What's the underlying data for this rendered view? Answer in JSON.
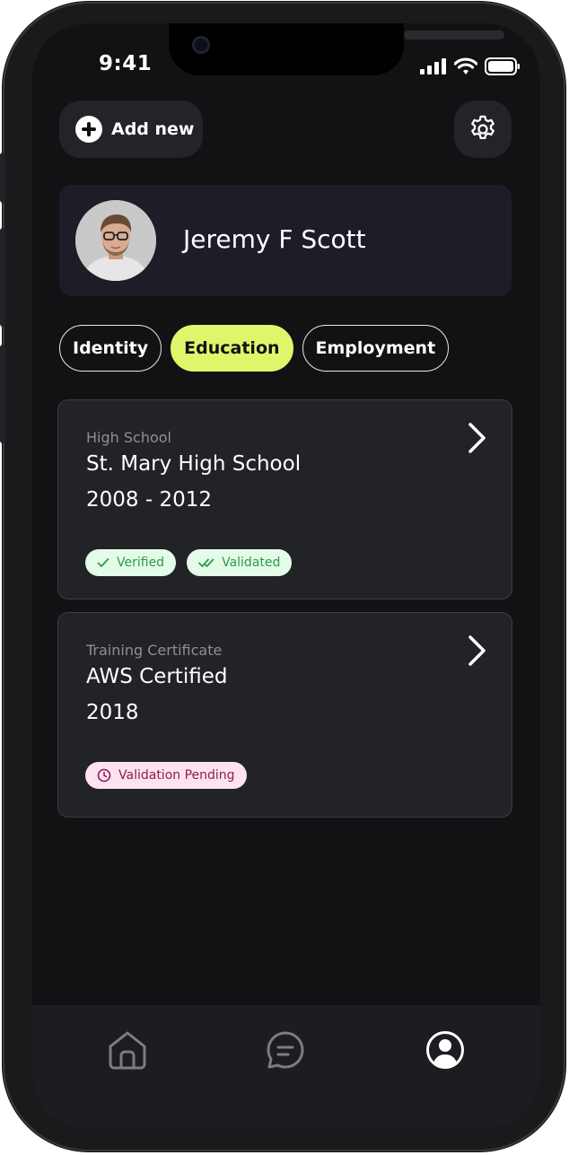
{
  "status_bar": {
    "time": "9:41"
  },
  "header": {
    "add_label": "Add new"
  },
  "profile": {
    "name": "Jeremy F Scott"
  },
  "tabs": [
    {
      "label": "Identity",
      "active": false
    },
    {
      "label": "Education",
      "active": true
    },
    {
      "label": "Employment",
      "active": false
    }
  ],
  "records": [
    {
      "type": "High School",
      "name": "St. Mary High School",
      "years": "2008 - 2012",
      "badges": [
        {
          "label": "Verified",
          "icon": "check-icon",
          "color": "#2f9b4a"
        },
        {
          "label": "Validated",
          "icon": "double-check-icon",
          "color": "#2f9b4a"
        }
      ]
    },
    {
      "type": "Training Certificate",
      "name": "AWS Certified",
      "years": "2018",
      "badges": [
        {
          "label": "Validation Pending",
          "icon": "clock-icon",
          "color": "#8b1e55"
        }
      ]
    }
  ],
  "bottom_nav": [
    {
      "icon": "home-icon",
      "active": false
    },
    {
      "icon": "chat-icon",
      "active": false
    },
    {
      "icon": "profile-icon",
      "active": true
    }
  ],
  "colors": {
    "accent": "#dff66b",
    "background": "#121214",
    "card": "#222326",
    "verified_bg": "#e3fbe8",
    "pending_bg": "#fde3ef"
  }
}
